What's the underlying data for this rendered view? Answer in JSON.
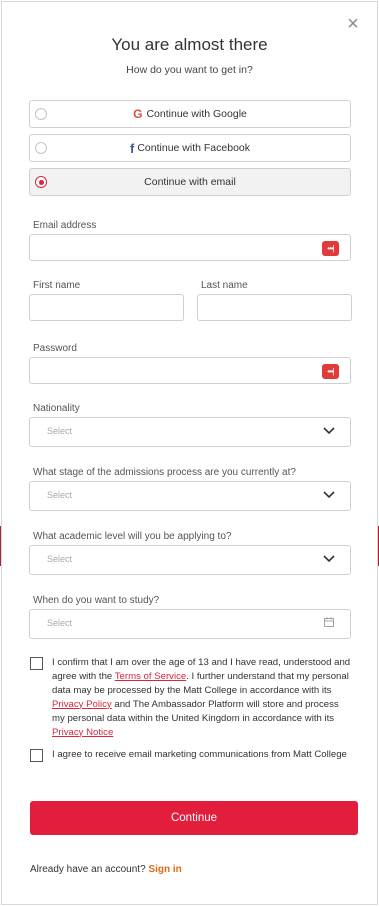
{
  "modal": {
    "close_glyph": "×",
    "title": "You are almost there",
    "subtitle": "How do you want to get in?"
  },
  "options": {
    "google_label": "Continue with Google",
    "facebook_label": "Continue with Facebook",
    "email_label": "Continue with email",
    "selected": "email"
  },
  "fields": {
    "email_label": "Email address",
    "first_name_label": "First name",
    "last_name_label": "Last name",
    "password_label": "Password",
    "nationality_label": "Nationality",
    "nationality_placeholder": "Select",
    "stage_label": "What stage of the admissions process are you currently at?",
    "stage_placeholder": "Select",
    "level_label": "What academic level will you be applying to?",
    "level_placeholder": "Select",
    "study_label": "When do you want to study?",
    "study_placeholder": "Select",
    "password_manager_glyph": "•••|"
  },
  "consent": {
    "terms_text_1": "I confirm that I am over the age of 13 and I have read, understood and agree with the ",
    "terms_link": "Terms of Service",
    "terms_text_2": ". I further understand that my personal data may be processed by the Matt College in accordance with its ",
    "privacy_policy_link": "Privacy Policy",
    "terms_text_3": "  and The Ambassador Platform will store and process my personal data within the United Kingdom in accordance with its ",
    "privacy_notice_link": "Privacy Notice",
    "marketing_text": "I agree to receive email marketing communications from Matt College"
  },
  "actions": {
    "continue_label": "Continue",
    "have_account_text": "Already have an account?",
    "sign_in_label": "Sign in"
  },
  "icons": {
    "google": "google-icon",
    "facebook": "facebook-icon",
    "password_manager": "password-manager-icon",
    "chevron": "chevron-down-icon",
    "calendar": "calendar-icon",
    "close": "close-icon"
  },
  "colors": {
    "accent": "#e31d3c",
    "link": "#d9263d",
    "sign_in": "#e06a16",
    "google": "#e04b3a",
    "facebook": "#3b5998"
  }
}
